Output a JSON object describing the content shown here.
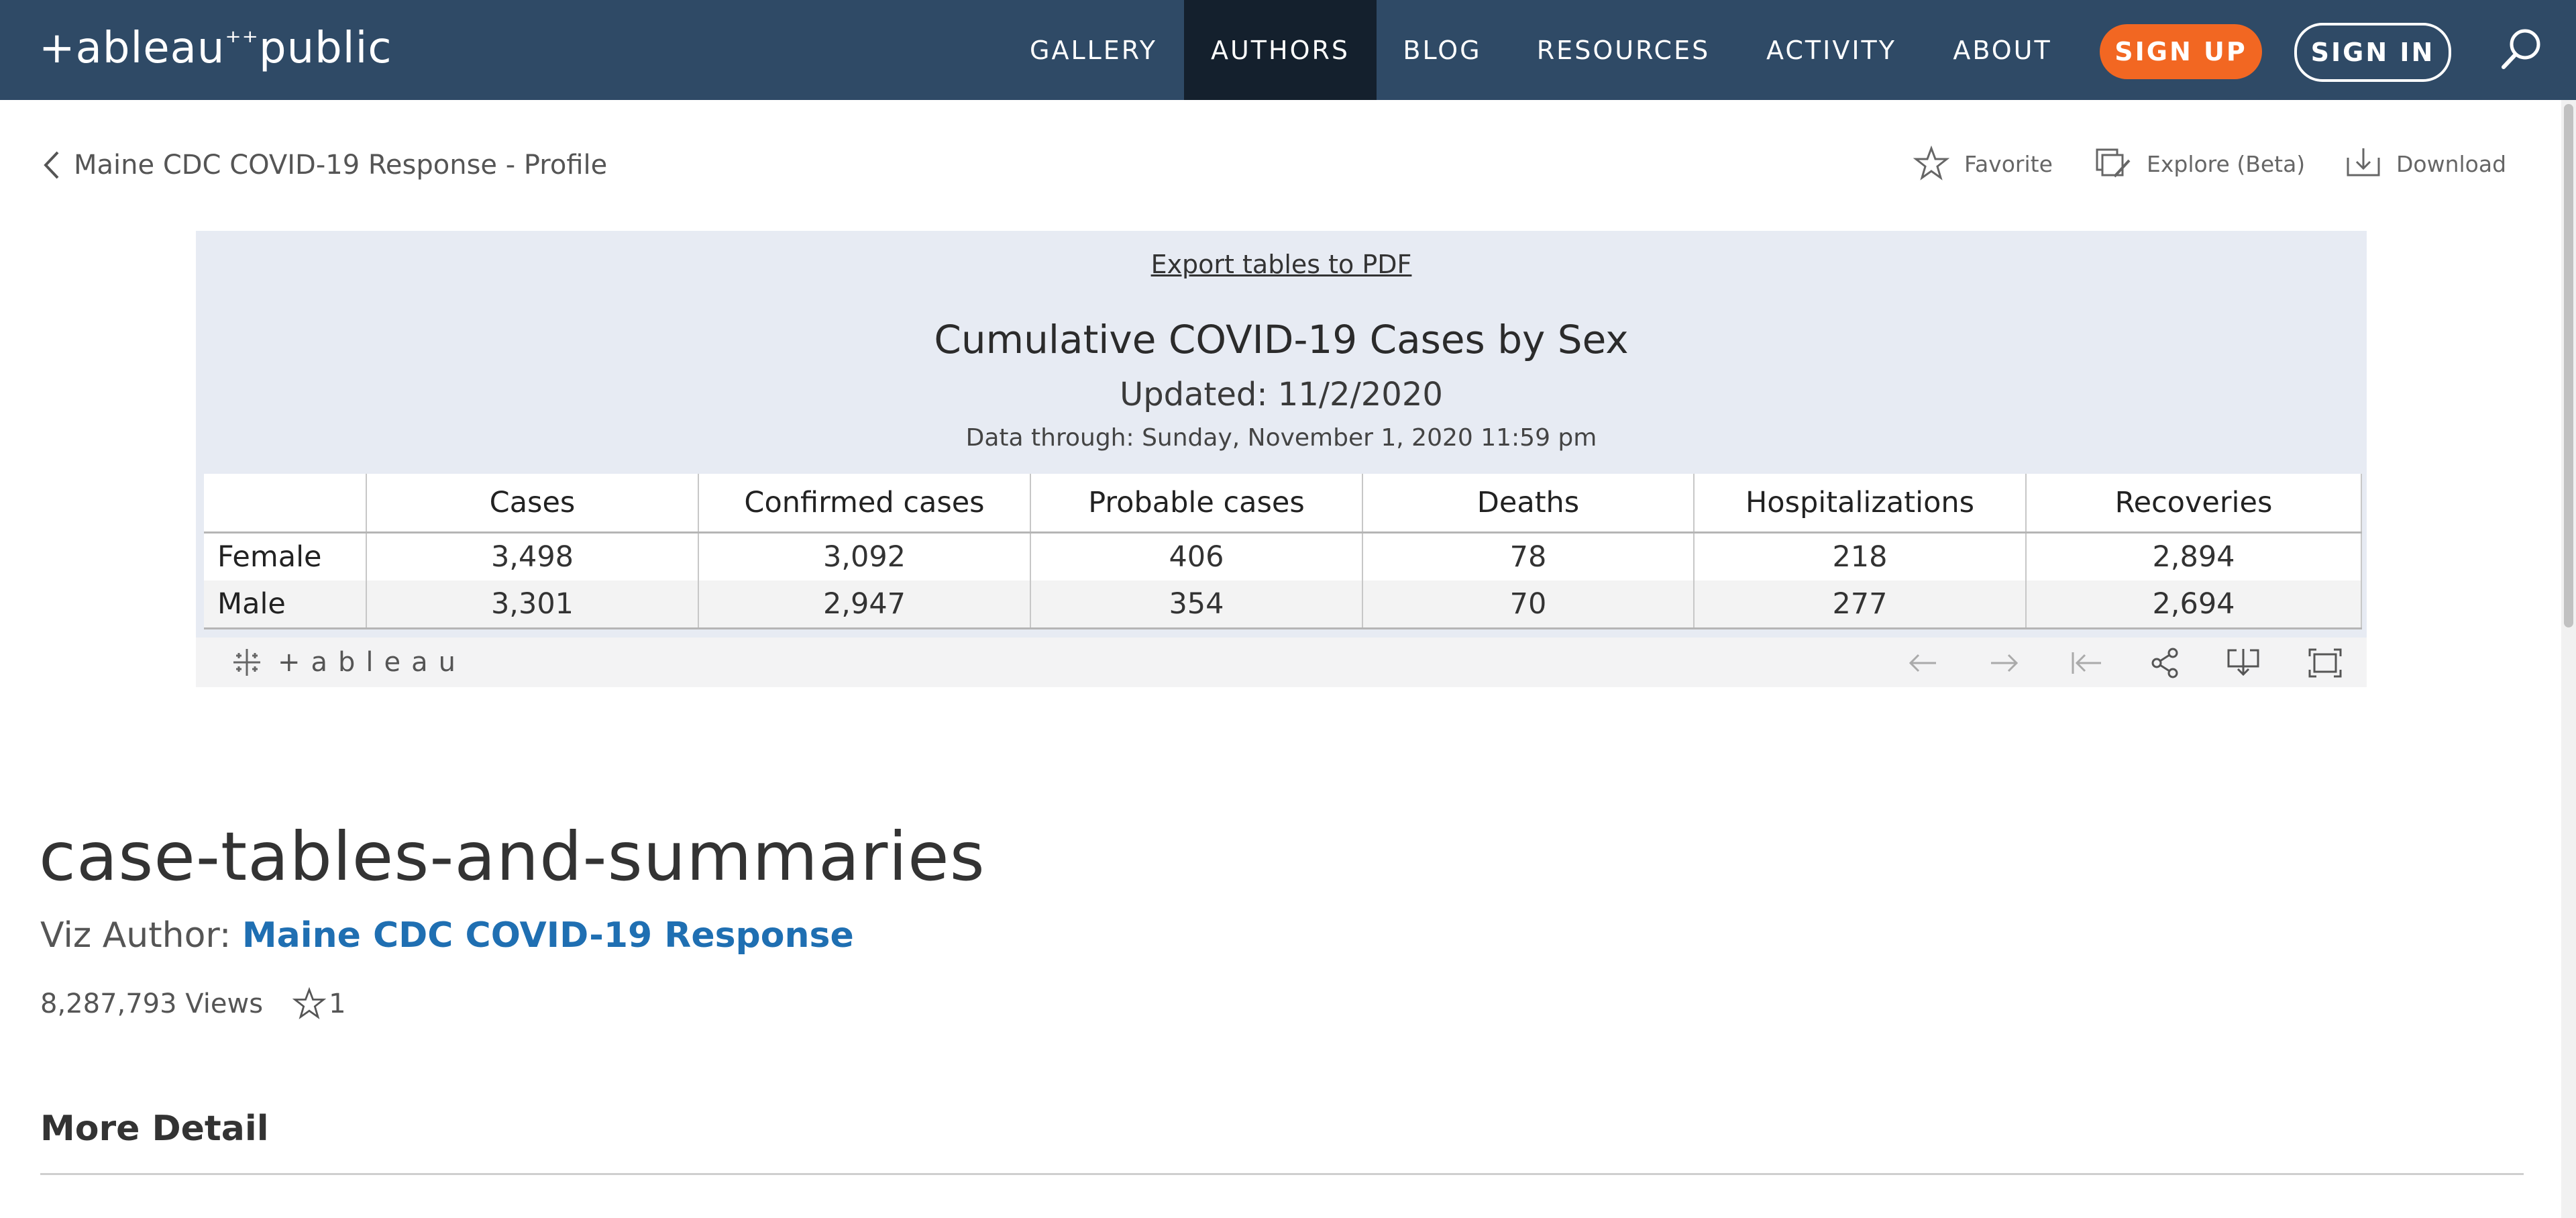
{
  "nav": {
    "logo_text_1": "+ableau",
    "logo_text_2": "public",
    "items": [
      {
        "label": "GALLERY"
      },
      {
        "label": "AUTHORS"
      },
      {
        "label": "BLOG"
      },
      {
        "label": "RESOURCES"
      },
      {
        "label": "ACTIVITY"
      },
      {
        "label": "ABOUT"
      }
    ],
    "active": "AUTHORS",
    "signup_label": "SIGN UP",
    "signin_label": "SIGN IN",
    "colors": {
      "bar": "#2f4a66",
      "active": "#14202d",
      "signup": "#f26722"
    }
  },
  "subheader": {
    "back_label": "Maine CDC COVID-19 Response - Profile",
    "favorite_label": "Favorite",
    "explore_label": "Explore (Beta)",
    "download_label": "Download"
  },
  "viz": {
    "export_label": "Export tables to PDF",
    "title": "Cumulative COVID-19 Cases by Sex",
    "updated": "Updated: 11/2/2020",
    "data_through": "Data through: Sunday, November 1, 2020 11:59 pm",
    "columns": [
      "",
      "Cases",
      "Confirmed cases",
      "Probable cases",
      "Deaths",
      "Hospitalizations",
      "Recoveries"
    ],
    "rows": [
      {
        "label": "Female",
        "cells": [
          "3,498",
          "3,092",
          "406",
          "78",
          "218",
          "2,894"
        ]
      },
      {
        "label": "Male",
        "cells": [
          "3,301",
          "2,947",
          "354",
          "70",
          "277",
          "2,694"
        ]
      }
    ],
    "toolbar_logo": "+ableau",
    "background": "#e7ebf3"
  },
  "info": {
    "viz_name": "case-tables-and-summaries",
    "author_prefix": "Viz Author: ",
    "author_name": "Maine CDC COVID-19 Response",
    "views": "8,287,793 Views",
    "favorites": "1",
    "more_detail": "More Detail",
    "author_color": "#1f6fb2"
  }
}
